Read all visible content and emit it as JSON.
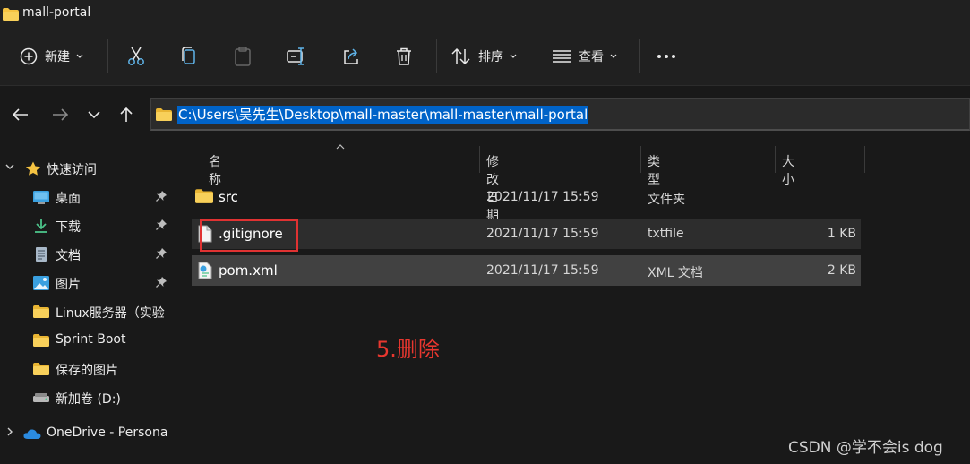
{
  "window": {
    "title": "mall-portal"
  },
  "toolbar": {
    "new_label": "新建",
    "sort_label": "排序",
    "view_label": "查看"
  },
  "address": {
    "path": "C:\\Users\\吴先生\\Desktop\\mall-master\\mall-master\\mall-portal"
  },
  "sidebar": {
    "quick_access": "快速访问",
    "items": [
      {
        "label": "桌面",
        "icon": "desktop-icon",
        "pinned": true
      },
      {
        "label": "下载",
        "icon": "download-icon",
        "pinned": true
      },
      {
        "label": "文档",
        "icon": "document-icon",
        "pinned": true
      },
      {
        "label": "图片",
        "icon": "pictures-icon",
        "pinned": true
      },
      {
        "label": "Linux服务器（实验",
        "icon": "folder-icon",
        "pinned": false
      },
      {
        "label": "Sprint Boot",
        "icon": "folder-icon",
        "pinned": false
      },
      {
        "label": "保存的图片",
        "icon": "folder-icon",
        "pinned": false
      },
      {
        "label": "新加卷 (D:)",
        "icon": "drive-icon",
        "pinned": false
      }
    ],
    "onedrive": "OneDrive - Persona"
  },
  "columns": {
    "name": "名称",
    "modified": "修改日期",
    "type": "类型",
    "size": "大小"
  },
  "files": [
    {
      "name": "src",
      "modified": "2021/11/17 15:59",
      "type": "文件夹",
      "size": "",
      "icon": "folder-icon"
    },
    {
      "name": ".gitignore",
      "modified": "2021/11/17 15:59",
      "type": "txtfile",
      "size": "1 KB",
      "icon": "file-icon"
    },
    {
      "name": "pom.xml",
      "modified": "2021/11/17 15:59",
      "type": "XML 文档",
      "size": "2 KB",
      "icon": "xml-file-icon"
    }
  ],
  "annotation": "5.删除",
  "watermark": "CSDN @学不会is dog",
  "colors": {
    "accent": "#0063c8",
    "annotation": "#e8372f",
    "folder": "#f5c342"
  }
}
